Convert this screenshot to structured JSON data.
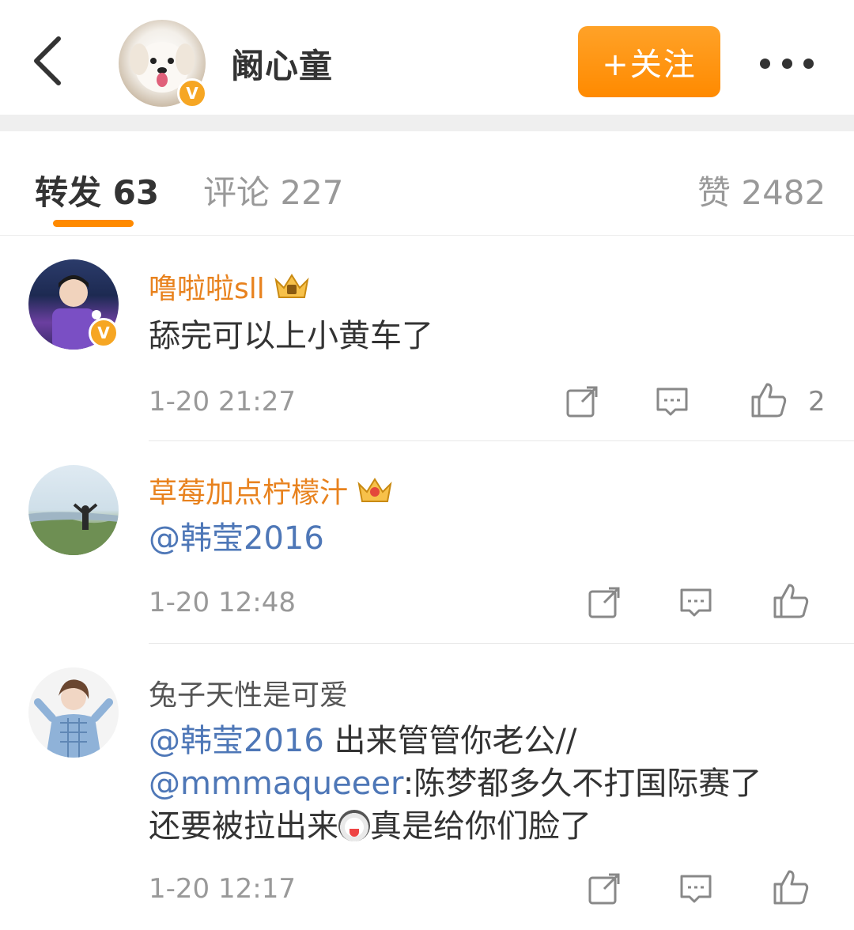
{
  "header": {
    "back_label": "<",
    "author_name": "阚心童",
    "verified_mark": "V",
    "follow_label": "+关注",
    "more_icon": "more-dots-icon"
  },
  "tabs": {
    "repost": "转发 63",
    "comment": "评论 227",
    "like": "赞 2482"
  },
  "comments": [
    {
      "username": "噜啦啦sll",
      "text": "舔完可以上小黄车了",
      "time": "1-20 21:27",
      "likes": "2",
      "verified_mark": "V"
    },
    {
      "username": "草莓加点柠檬汁",
      "mention": "@韩莹2016",
      "time": "1-20 12:48"
    },
    {
      "username": "兔子天性是可爱",
      "line1_mention": "@韩莹2016",
      "line1_text": " 出来管管你老公//",
      "line2_mention": "@mmmaqueeer",
      "line2_text": ":陈梦都多久不打国际赛了",
      "line3_text_a": "还要被拉出来",
      "line3_text_b": "真是给你们脸了",
      "time": "1-20 12:17"
    }
  ],
  "colors": {
    "accent": "#ff8a00",
    "username": "#e8821e",
    "mention": "#4e77b7",
    "muted": "#999999"
  }
}
